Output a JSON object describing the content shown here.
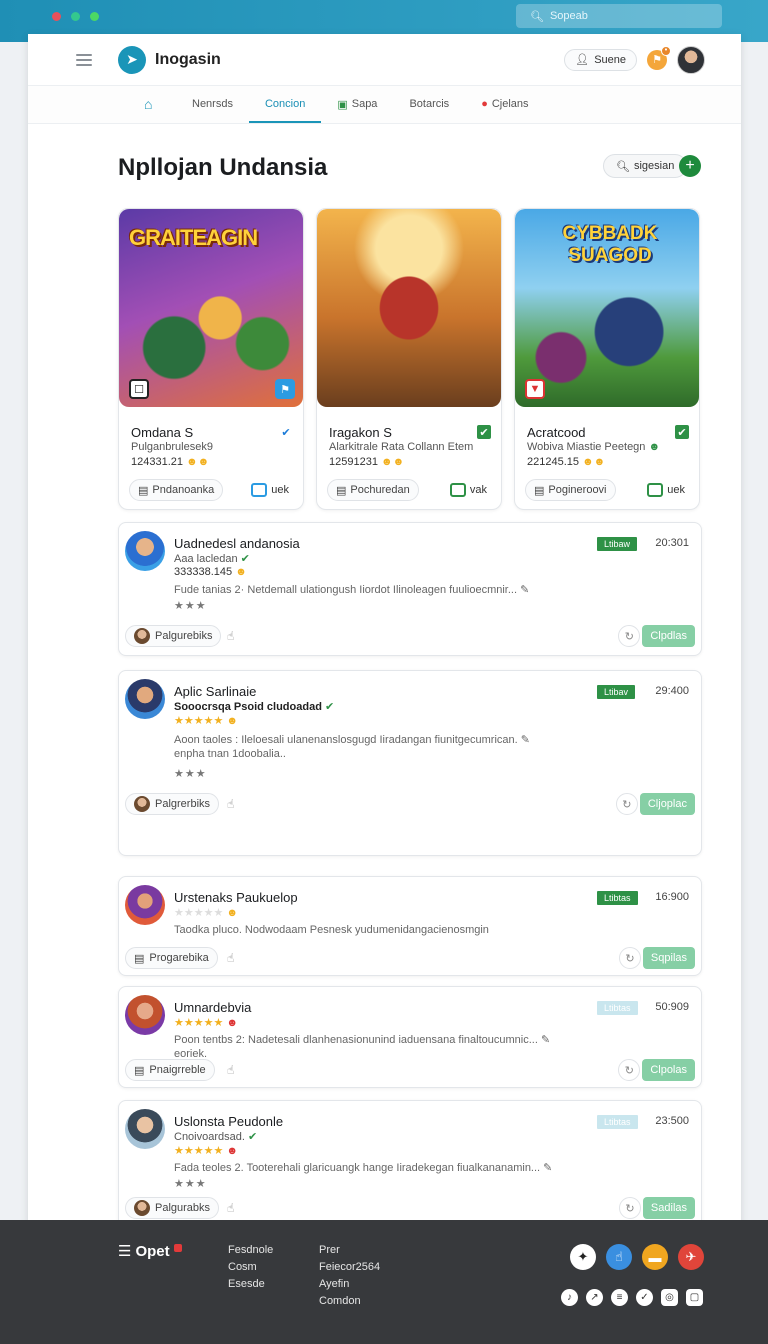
{
  "browser": {
    "search_placeholder": "Sopeab"
  },
  "app": {
    "brand": "Inogasin",
    "user_label": "Suene"
  },
  "nav": [
    {
      "label": "Nenrsds"
    },
    {
      "label": "Concion"
    },
    {
      "label": "Sapa"
    },
    {
      "label": "Botarcis"
    },
    {
      "label": "Cjelans"
    }
  ],
  "page": {
    "title": "Npllojan Undansia",
    "search_label": "sigesian",
    "add_label": "+"
  },
  "cards": [
    {
      "art_title": "GRAITEAGIN",
      "title": "Omdana S",
      "sub": "Pulganbrulesek9",
      "score": "124331.21",
      "button": "Pndanoanka",
      "view": "uek"
    },
    {
      "art_title": "",
      "title": "Iragakon S",
      "sub": "Alarkitrale Rata Collann Etem",
      "score": "12591231",
      "button": "Pochuredan",
      "view": "vak"
    },
    {
      "art_title": "CYBBADK SUAGOD",
      "title": "Acratcood",
      "sub": "Wobiva Miastie Peetegn",
      "score": "221245.15",
      "button": "Pogineroovi",
      "view": "uek"
    }
  ],
  "rows": [
    {
      "name": "Uadnedesl andanosia",
      "sub": "Aaa lacledan",
      "score": "333338.145",
      "desc": "Fude tanias 2· Netdemall ulationgush Iiordot Ilinoleagen fuulioecmnir...",
      "desc2": "",
      "stars": "★★★",
      "status": "Ltibaw",
      "num": "20:301",
      "foot": "Palgurebiks",
      "action": "Clpdlas",
      "status_pale": false
    },
    {
      "name": "Aplic Sarlinaie",
      "sub": "Sooocrsqa Psoid cludoadad",
      "score": "★★★★★",
      "desc": "Aoon taoles : Ileloesali ulanenanslosgugd Iiradangan fiunitgecumrican.",
      "desc2": "enpha tnan 1doobalia..",
      "stars": "★★★",
      "status": "Ltibav",
      "num": "29:400",
      "foot": "Palgrerbiks",
      "action": "Cljoplac",
      "status_pale": false
    },
    {
      "name": "Urstenaks Paukuelop",
      "sub": "",
      "score": "★★★★★",
      "desc": "Taodka pluco. Nodwodaam Pesnesk yudumenidangacienosmgin",
      "desc2": "",
      "stars": "",
      "status": "Ltibtas",
      "num": "16:900",
      "foot": "Progarebika",
      "action": "Sqpilas",
      "status_pale": false
    },
    {
      "name": "Umnardebvia",
      "sub": "",
      "score": "★★★★★",
      "desc": "Poon tentbs 2: Nadetesali dlanhenasionunind iaduensana finaltoucumnic...",
      "desc2": "eoriek.",
      "stars": "",
      "status": "Ltibtas",
      "num": "50:909",
      "foot": "Pnaigrreble",
      "action": "Clpolas",
      "status_pale": true
    },
    {
      "name": "Uslonsta Peudonle",
      "sub": "Cnoivoardsad.",
      "score": "★★★★★",
      "desc": "Fada teoles 2. Tooterehali glaricuangk hange Iiradekegan fiualkananamin...",
      "desc2": "",
      "stars": "★★★",
      "status": "Ltibtas",
      "num": "23:500",
      "foot": "Palgurabks",
      "action": "Sadilas",
      "status_pale": true
    }
  ],
  "footer": {
    "logo": "Opet",
    "col1": [
      "Fesdnole",
      "Cosm",
      "Esesde"
    ],
    "col2": [
      "Prer",
      "Feiecor2564",
      "Ayefin",
      "Comdon"
    ]
  },
  "colors": {
    "accent": "#1a95b8",
    "green": "#2e9146",
    "apply": "#86cfa5",
    "footer": "#37393c"
  }
}
